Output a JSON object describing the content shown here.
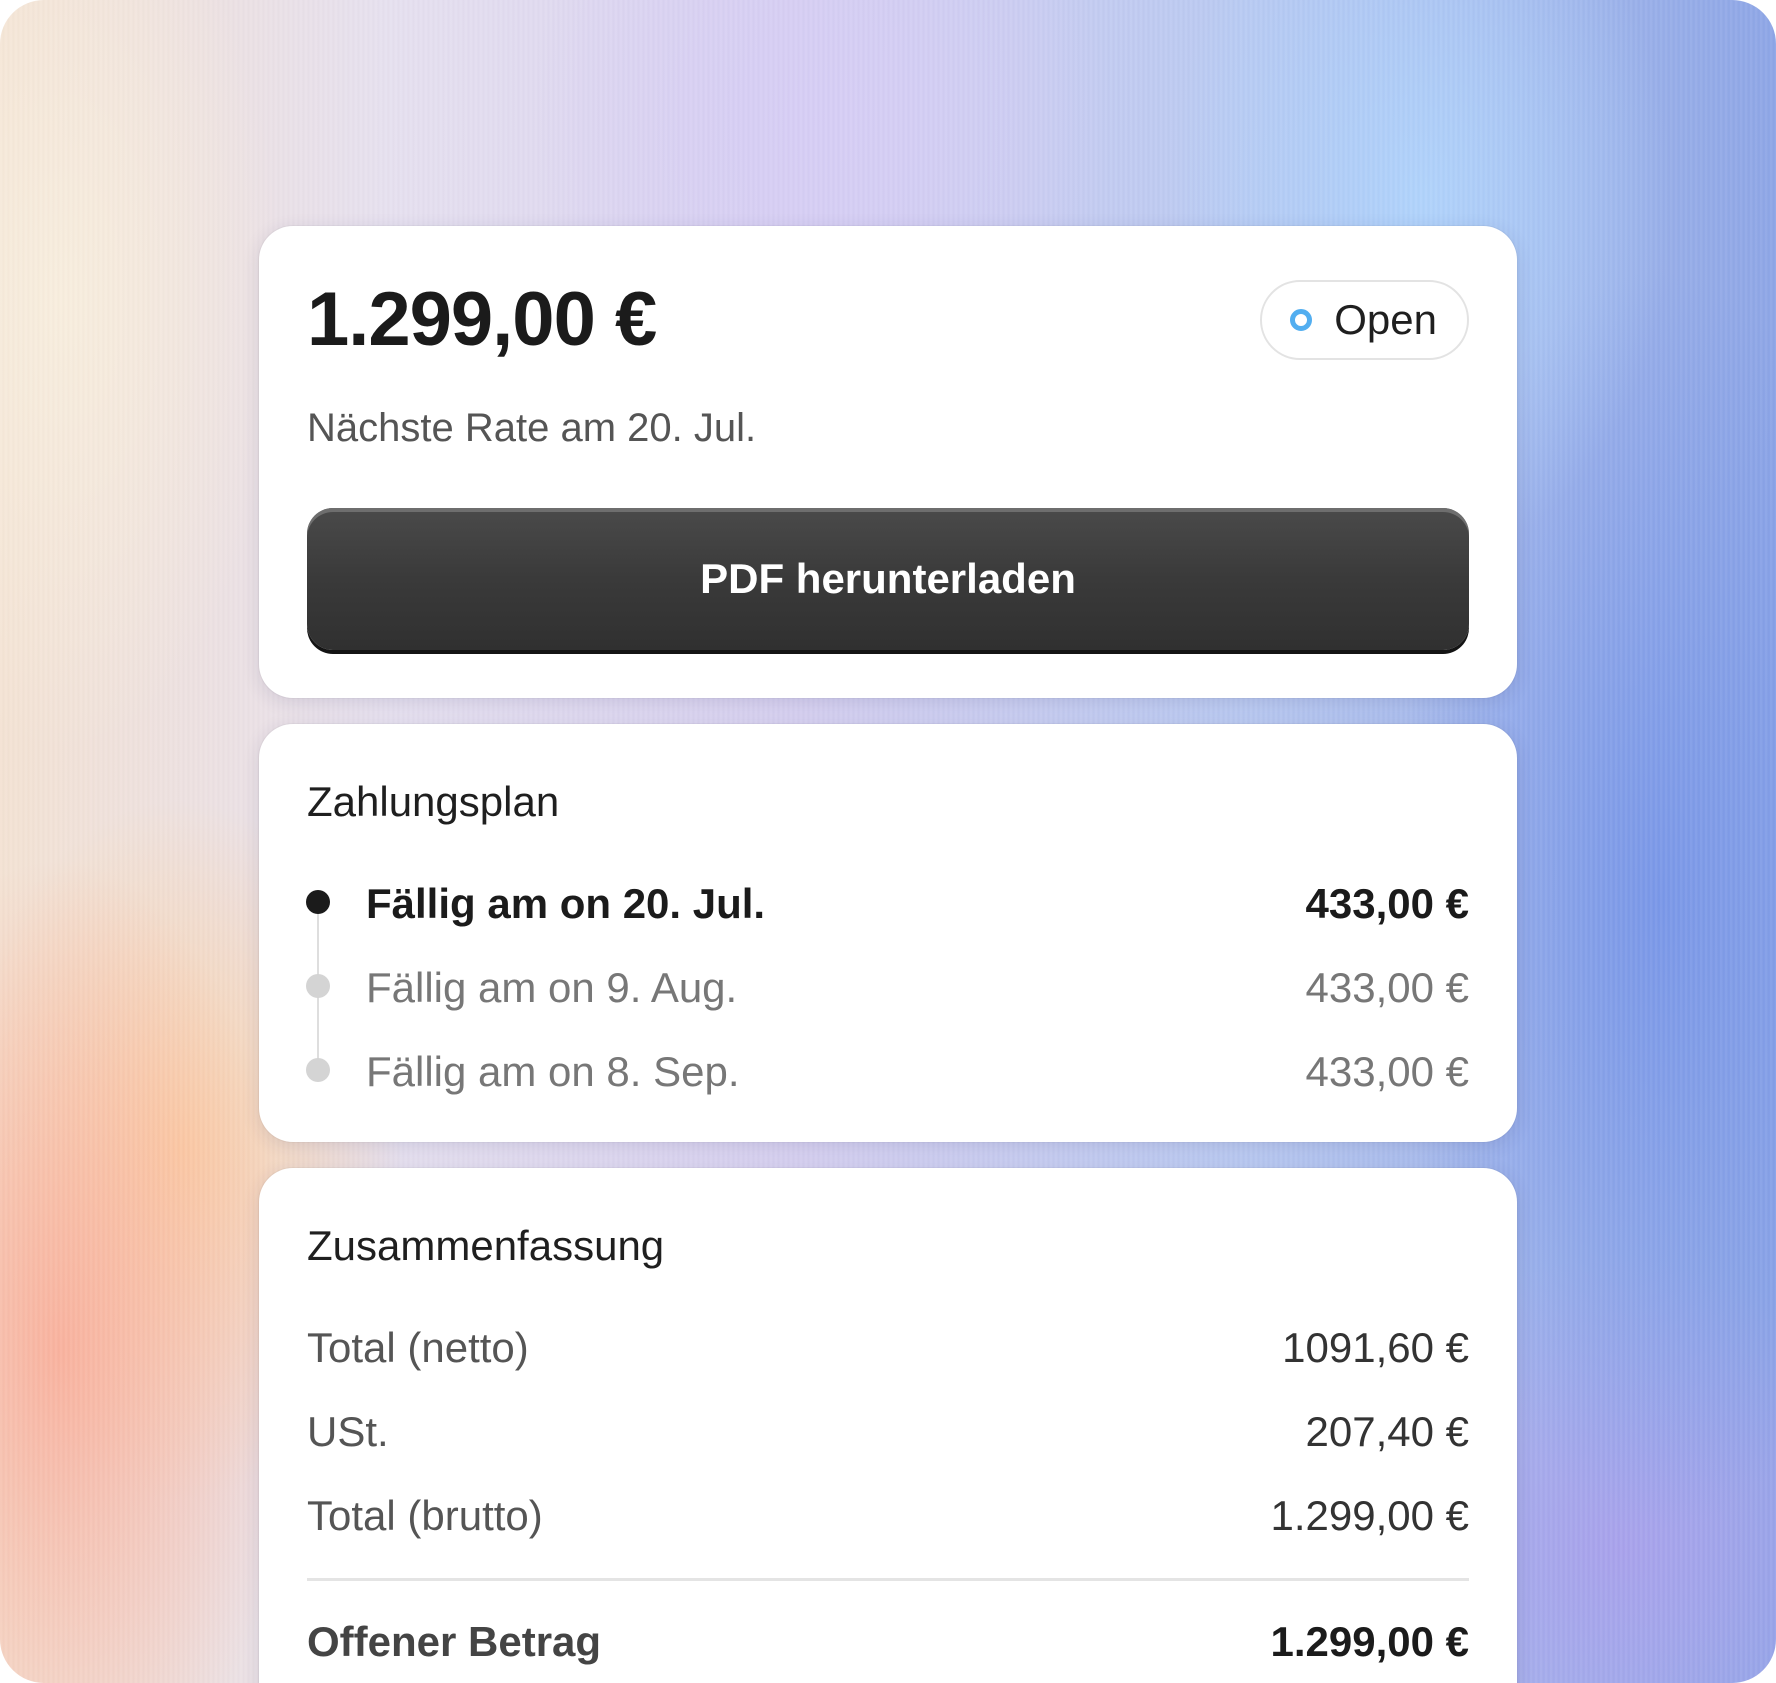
{
  "invoice": {
    "amount": "1.299,00 €",
    "status": "Open",
    "next_rate": "Nächste Rate am 20. Jul.",
    "download_button": "PDF herunterladen"
  },
  "payment_plan": {
    "title": "Zahlungsplan",
    "items": [
      {
        "label": "Fällig am on 20. Jul.",
        "amount": "433,00 €",
        "active": true
      },
      {
        "label": "Fällig am on 9. Aug.",
        "amount": "433,00 €",
        "active": false
      },
      {
        "label": "Fällig am on 8. Sep.",
        "amount": "433,00 €",
        "active": false
      }
    ]
  },
  "summary": {
    "title": "Zusammenfassung",
    "rows": [
      {
        "label": "Total (netto)",
        "value": "1091,60 €"
      },
      {
        "label": "USt.",
        "value": "207,40 €"
      },
      {
        "label": "Total (brutto)",
        "value": "1.299,00 €"
      }
    ],
    "total": {
      "label": "Offener Betrag",
      "value": "1.299,00 €"
    }
  },
  "colors": {
    "status_ring": "#52aef0",
    "button_bg": "#3a3a3a",
    "active_dot": "#1b1b1b",
    "inactive_dot": "#d4d4d4"
  }
}
